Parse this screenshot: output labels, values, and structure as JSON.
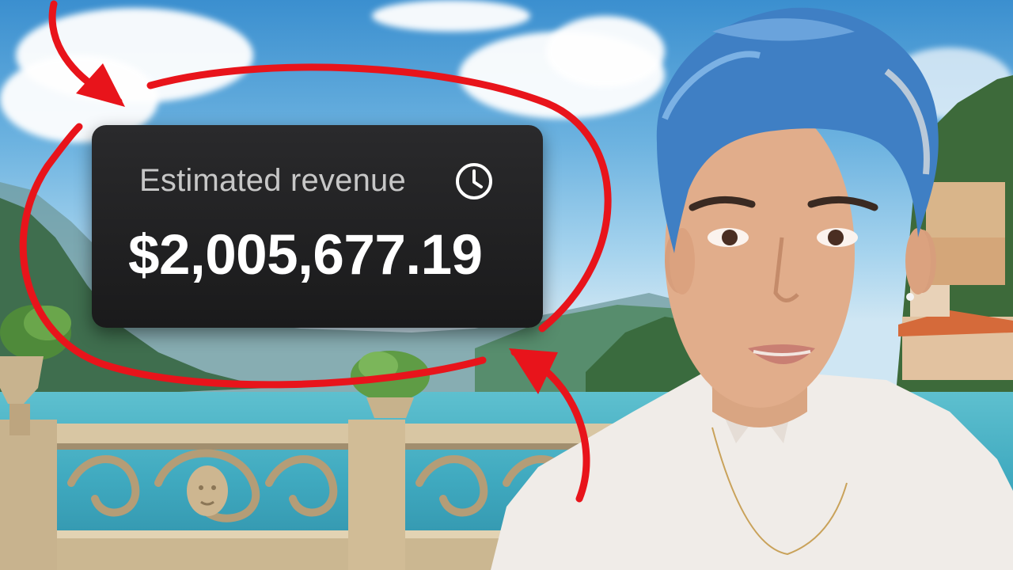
{
  "revenue_card": {
    "title": "Estimated revenue",
    "amount": "$2,005,677.19",
    "icon": "clock-icon"
  },
  "colors": {
    "annotation_red": "#e8141b",
    "card_background": "#1f1f20",
    "hair_blue": "#3f7fc4"
  }
}
